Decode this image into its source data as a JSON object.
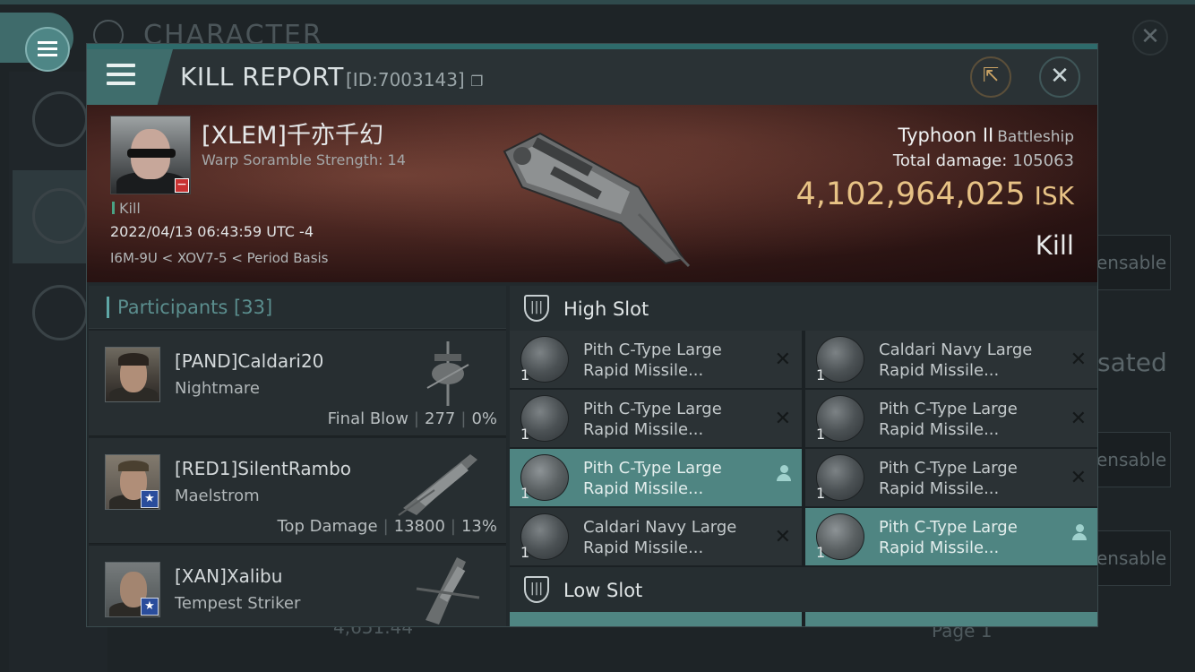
{
  "background": {
    "title": "CHARACTER",
    "right_labels": [
      "ensable",
      "sated",
      "ensable",
      "ensable"
    ],
    "bottom_value": "4,651.44",
    "bottom_page": "Page 1"
  },
  "header": {
    "title": "KILL REPORT",
    "id_label": "[ID:7003143]"
  },
  "victim": {
    "name": "[XLEM]千亦千幻",
    "subtitle": "Warp Soramble Strength: 14",
    "tag": "Kill",
    "date": "2022/04/13 06:43:59 UTC -4",
    "location": "I6M-9U < XOV7-5 < Period Basis",
    "ship": "Typhoon II",
    "ship_class": "Battleship",
    "total_damage_label": "Total damage:",
    "total_damage": "105063",
    "isk_value": "4,102,964,025",
    "isk_unit": "ISK",
    "result": "Kill"
  },
  "participants": {
    "title": "Participants",
    "count": "[33]",
    "items": [
      {
        "name": "[PAND]Caldari20",
        "ship": "Nightmare",
        "role": "Final Blow",
        "damage": "277",
        "percent": "0%"
      },
      {
        "name": "[RED1]SilentRambo",
        "ship": "Maelstrom",
        "role": "Top Damage",
        "damage": "13800",
        "percent": "13%"
      },
      {
        "name": "[XAN]Xalibu",
        "ship": "Tempest Striker",
        "role": "",
        "damage": "",
        "percent": ""
      }
    ]
  },
  "slots": {
    "high": {
      "title": "High Slot",
      "modules": [
        {
          "line1": "Pith C-Type Large",
          "line2": "Rapid Missile...",
          "qty": "1",
          "state": "destroyed"
        },
        {
          "line1": "Caldari Navy Large",
          "line2": "Rapid Missile...",
          "qty": "1",
          "state": "destroyed"
        },
        {
          "line1": "Pith C-Type Large",
          "line2": "Rapid Missile...",
          "qty": "1",
          "state": "destroyed"
        },
        {
          "line1": "Pith C-Type Large",
          "line2": "Rapid Missile...",
          "qty": "1",
          "state": "destroyed"
        },
        {
          "line1": "Pith C-Type Large",
          "line2": "Rapid Missile...",
          "qty": "1",
          "state": "dropped"
        },
        {
          "line1": "Pith C-Type Large",
          "line2": "Rapid Missile...",
          "qty": "1",
          "state": "destroyed"
        },
        {
          "line1": "Caldari Navy Large",
          "line2": "Rapid Missile...",
          "qty": "1",
          "state": "destroyed"
        },
        {
          "line1": "Pith C-Type Large",
          "line2": "Rapid Missile...",
          "qty": "1",
          "state": "dropped"
        }
      ]
    },
    "low": {
      "title": "Low Slot"
    }
  },
  "colors": {
    "accent": "#4f8582",
    "isk_gold": "#e7c285",
    "kill_green": "#4aa284"
  },
  "icons": {
    "menu": "hamburger-icon",
    "share": "share-icon",
    "close": "close-icon",
    "copy": "copy-icon",
    "slot": "shield-slot-icon",
    "destroyed": "x-icon",
    "dropped": "person-icon"
  }
}
